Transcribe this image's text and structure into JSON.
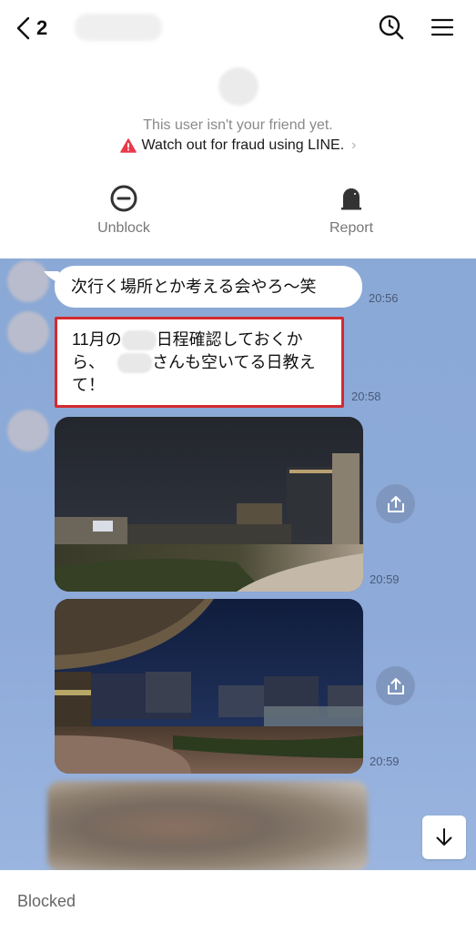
{
  "header": {
    "unread_count": "2",
    "contact_name_redacted": true,
    "icons": {
      "back": "chevron-left-icon",
      "search": "search-history-icon",
      "menu": "hamburger-menu-icon"
    }
  },
  "info": {
    "not_friend_text": "This user isn't your friend yet.",
    "fraud_warning": "Watch out for fraud using LINE.",
    "fraud_icon": "warning-triangle-icon",
    "warning_color": "#e8394a",
    "actions": [
      {
        "label": "Unblock",
        "icon": "minus-circle-icon"
      },
      {
        "label": "Report",
        "icon": "siren-icon"
      }
    ]
  },
  "chat": {
    "background_color": "#8aa9d6",
    "messages": [
      {
        "type": "text",
        "text": "次行く場所とか考える会やろ〜笑",
        "time": "20:56"
      },
      {
        "type": "text",
        "highlighted": true,
        "highlight_color": "#d42a2f",
        "line1_a": "11月の",
        "line1_b": "日程確認しておくか",
        "line2_a": "ら、",
        "line2_b": "さんも空いてる日教え",
        "line3": "て！",
        "time": "20:58"
      },
      {
        "type": "image",
        "description": "Night rooftop garden with city skyline",
        "time": "20:59"
      },
      {
        "type": "image",
        "description": "Night terrace with curved canopy and office buildings",
        "time": "20:59"
      },
      {
        "type": "image",
        "description": "Blurred image",
        "time": ""
      }
    ]
  },
  "footer": {
    "status": "Blocked"
  }
}
